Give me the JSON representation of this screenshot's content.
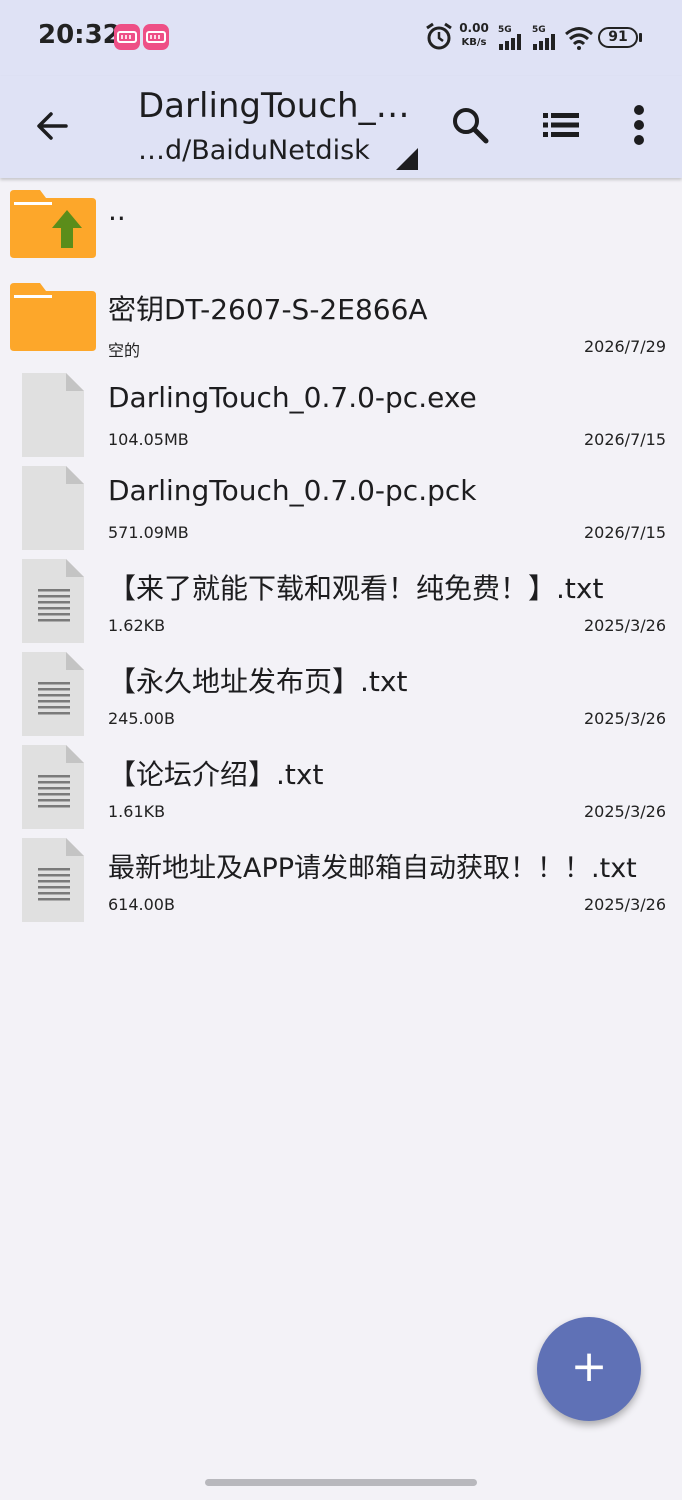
{
  "status_bar": {
    "time": "20:32",
    "net_speed_value": "0.00",
    "net_speed_unit": "KB/s",
    "signal1_label": "5G",
    "signal2_label": "5G",
    "battery": "91",
    "icons": [
      "alarm-icon",
      "signal-icon",
      "signal-icon",
      "wifi-icon",
      "battery-icon"
    ]
  },
  "toolbar": {
    "title": "DarlingTouch_…",
    "path": "…d/BaiduNetdisk",
    "icons": [
      "back-arrow-icon",
      "search-icon",
      "list-view-icon",
      "more-vert-icon",
      "dropdown-triangle-icon"
    ]
  },
  "files": [
    {
      "name": "..",
      "meta": "",
      "date": "",
      "type": "parent"
    },
    {
      "name": "密钥DT-2607-S-2E866A",
      "meta": "空的",
      "date": "2026/7/29",
      "type": "folder"
    },
    {
      "name": "DarlingTouch_0.7.0-pc.exe",
      "meta": "104.05MB",
      "date": "2026/7/15",
      "type": "file"
    },
    {
      "name": "DarlingTouch_0.7.0-pc.pck",
      "meta": "571.09MB",
      "date": "2026/7/15",
      "type": "file"
    },
    {
      "name": "【来了就能下载和观看！纯免费！】.txt",
      "meta": "1.62KB",
      "date": "2025/3/26",
      "type": "text"
    },
    {
      "name": "【永久地址发布页】.txt",
      "meta": "245.00B",
      "date": "2025/3/26",
      "type": "text"
    },
    {
      "name": "【论坛介绍】.txt",
      "meta": "1.61KB",
      "date": "2025/3/26",
      "type": "text"
    },
    {
      "name": "最新地址及APP请发邮箱自动获取！！！.txt",
      "meta": "614.00B",
      "date": "2025/3/26",
      "type": "text"
    }
  ],
  "fab": {
    "label": "+"
  },
  "colors": {
    "bar_bg": "#dfe2f5",
    "page_bg": "#f3f2f7",
    "folder": "#fda72a",
    "up_arrow": "#5b8d1a",
    "doc": "#e0e0e0",
    "fab": "#5f71b6"
  }
}
